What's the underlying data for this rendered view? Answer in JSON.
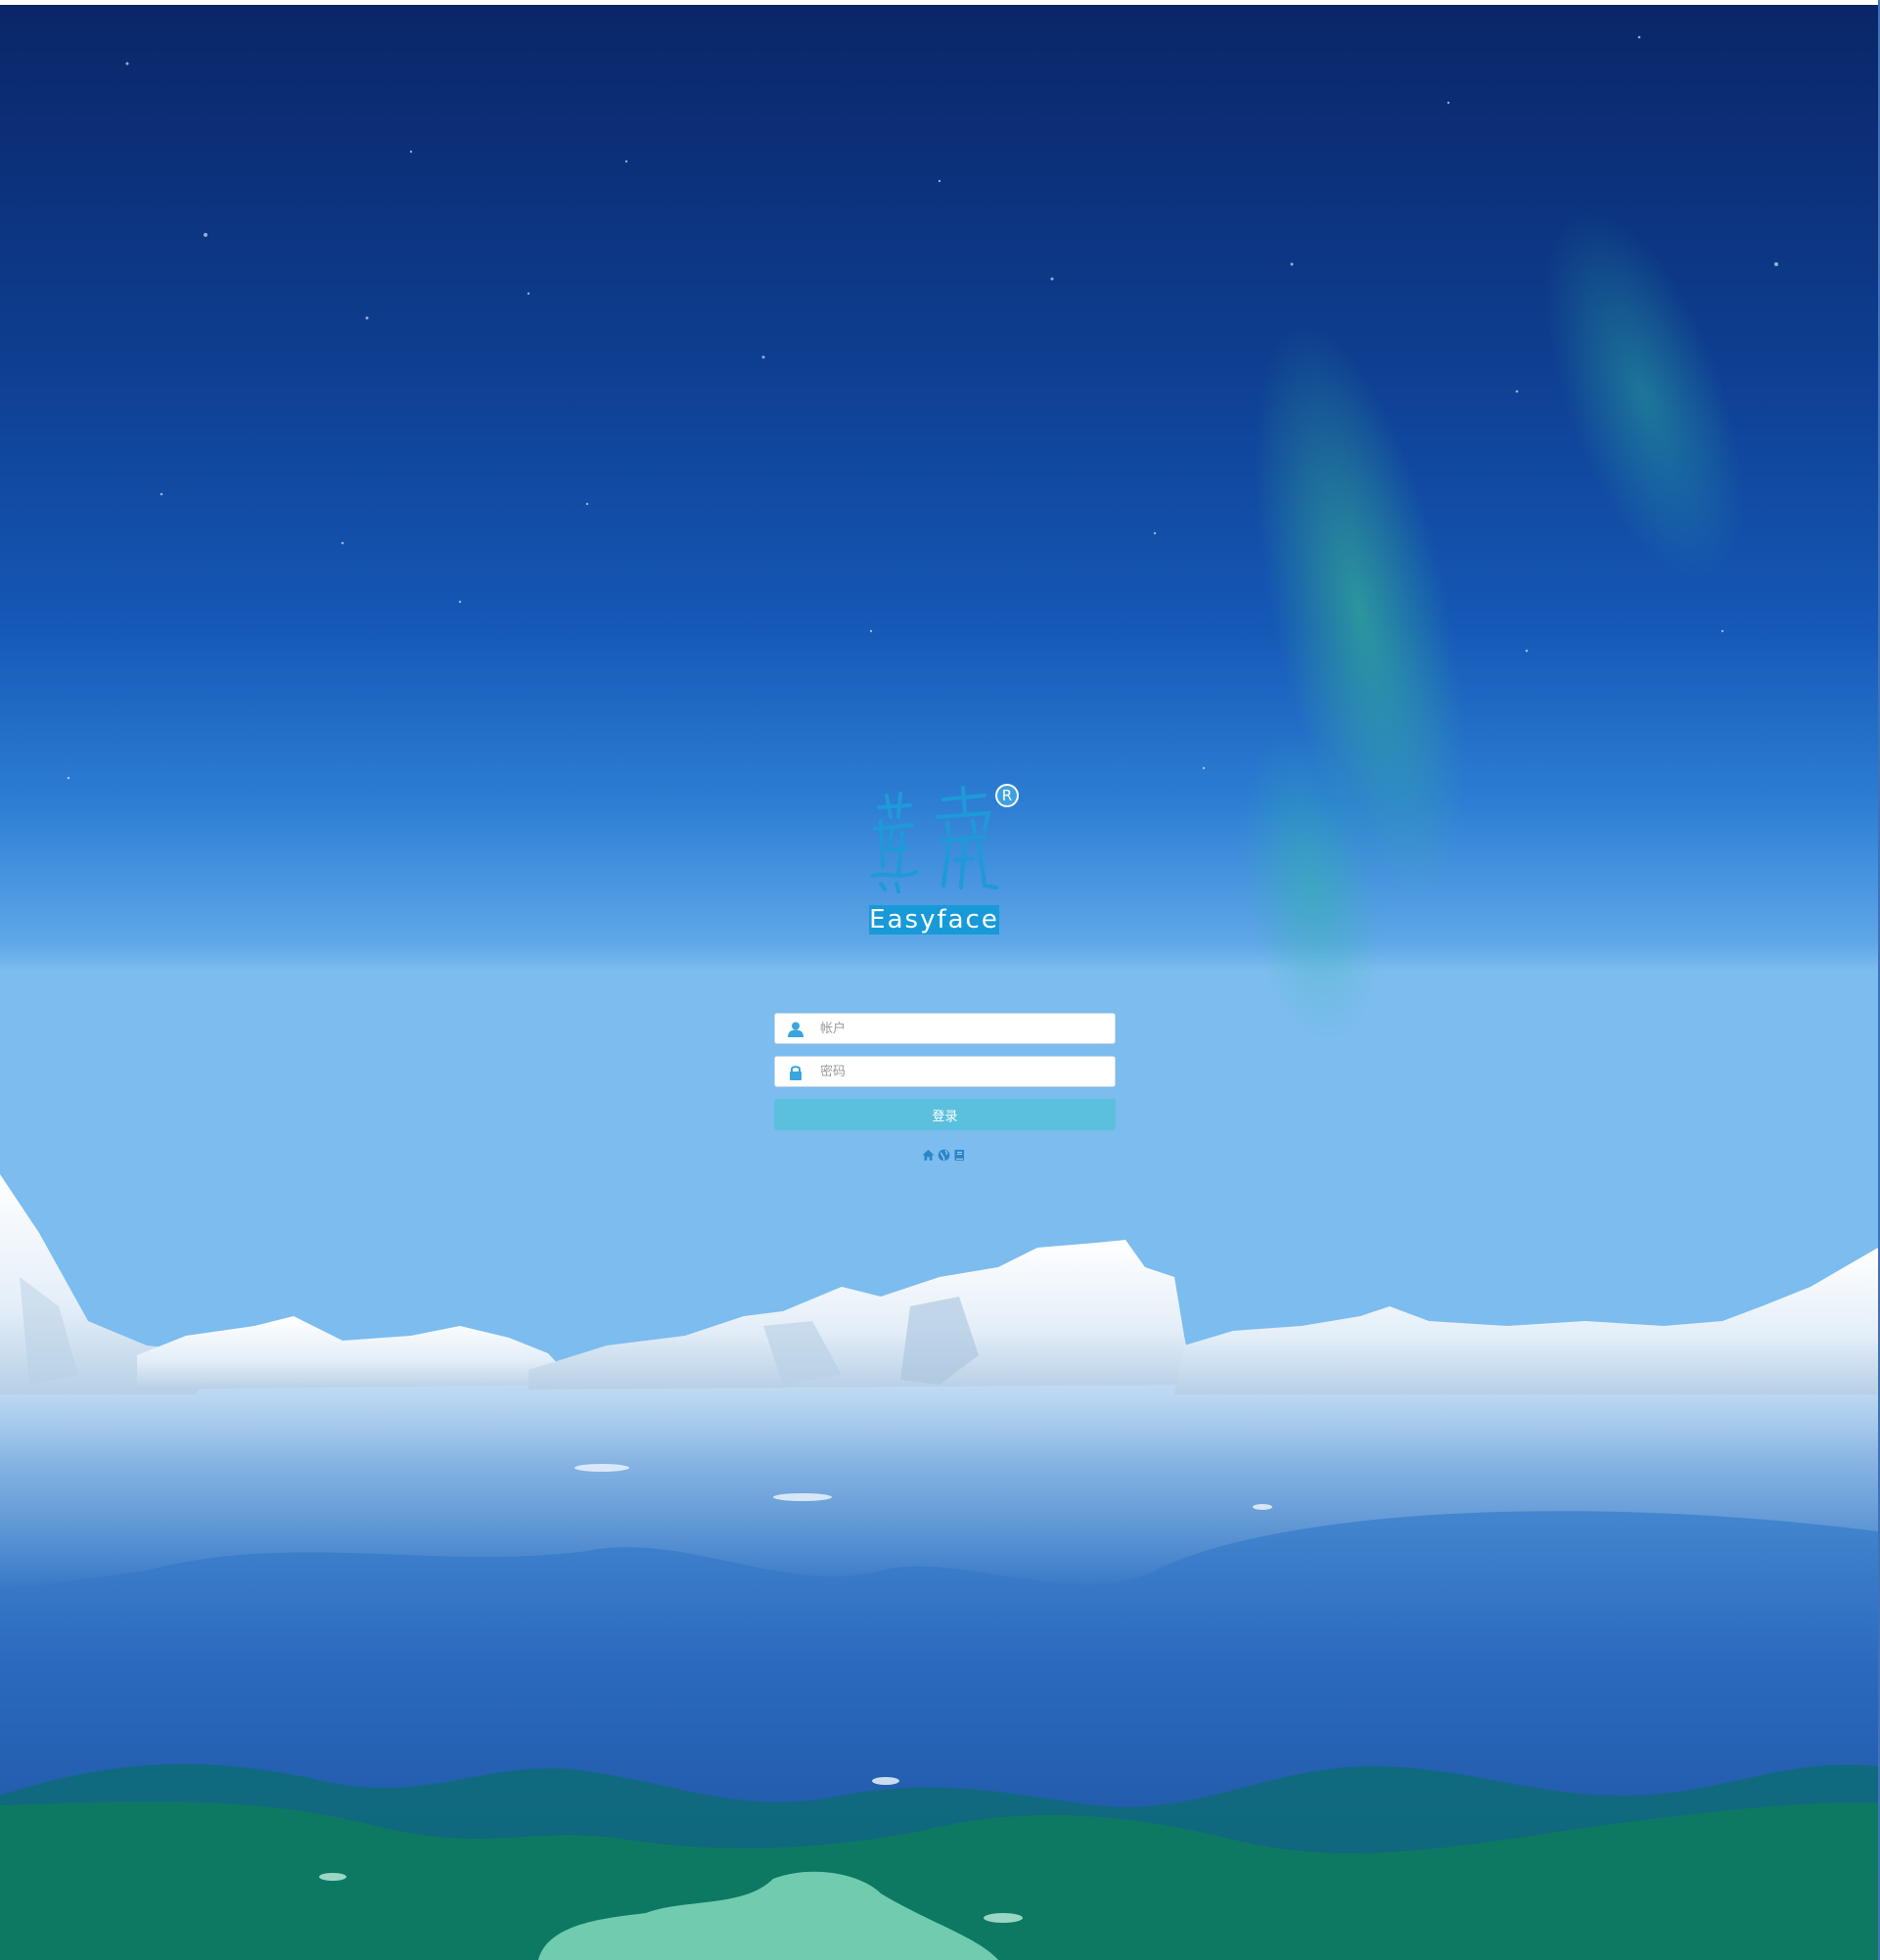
{
  "brand": {
    "name": "Easyface",
    "registered_mark": "R",
    "accent_color": "#189ad9"
  },
  "login": {
    "account_placeholder": "帐户",
    "password_placeholder": "密码",
    "account_value": "",
    "password_value": "",
    "submit_label": "登录",
    "button_color": "#5bc0de"
  },
  "icons": {
    "account_field_icon": "user-icon",
    "password_field_icon": "lock-icon",
    "footer_links": [
      "home-icon",
      "globe-icon",
      "book-icon"
    ]
  },
  "theme": {
    "sky_top": "#0a2a6a",
    "sky_mid": "#1763c0",
    "sky_horizon": "#5fa6e6",
    "sea": "#2a6fc0",
    "wave": "#0b7b6a"
  }
}
